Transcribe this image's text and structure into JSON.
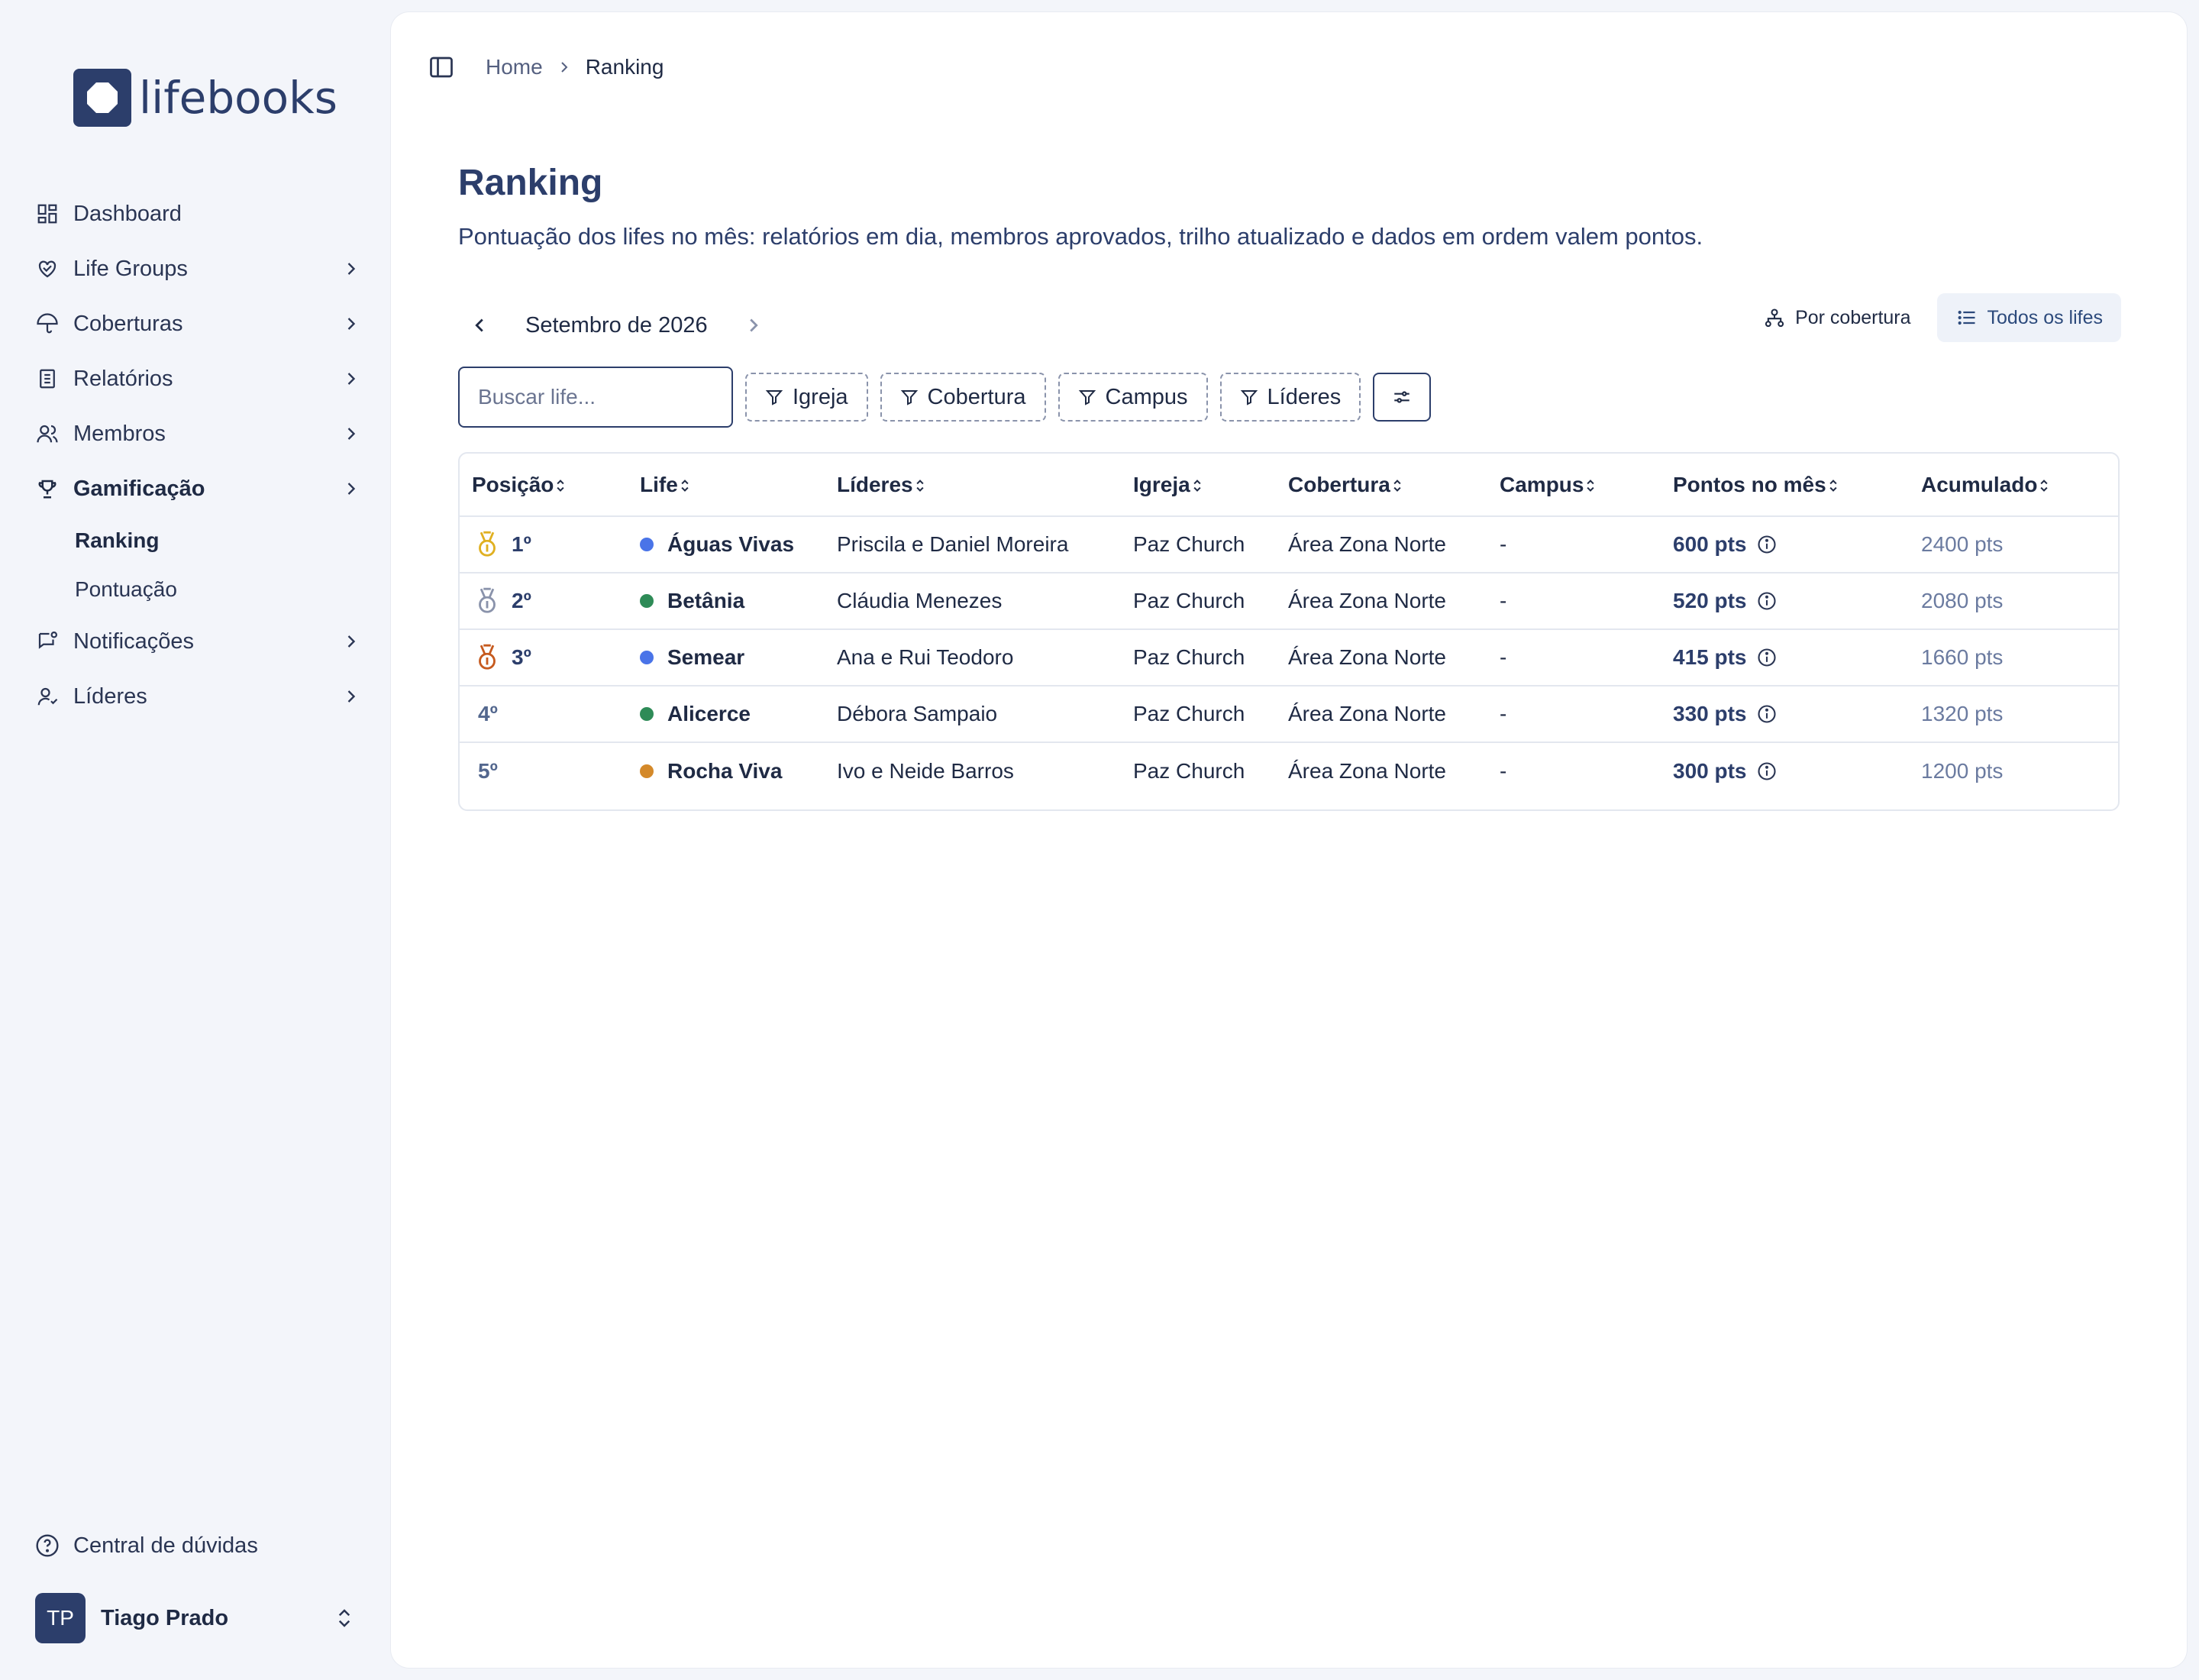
{
  "brand": {
    "name": "lifebooks"
  },
  "sidebar": {
    "items": [
      {
        "label": "Dashboard",
        "icon": "dashboard-icon",
        "has_children": false
      },
      {
        "label": "Life Groups",
        "icon": "heart-handshake-icon",
        "has_children": true
      },
      {
        "label": "Coberturas",
        "icon": "umbrella-icon",
        "has_children": true
      },
      {
        "label": "Relatórios",
        "icon": "report-icon",
        "has_children": true
      },
      {
        "label": "Membros",
        "icon": "users-icon",
        "has_children": true
      },
      {
        "label": "Gamificação",
        "icon": "trophy-icon",
        "has_children": true,
        "active": true
      }
    ],
    "sub_items": [
      {
        "label": "Ranking",
        "active": true
      },
      {
        "label": "Pontuação",
        "active": false
      }
    ],
    "items_after": [
      {
        "label": "Notificações",
        "icon": "message-bell-icon",
        "has_children": true
      },
      {
        "label": "Líderes",
        "icon": "user-leader-icon",
        "has_children": true
      }
    ],
    "help_label": "Central de dúvidas",
    "user": {
      "initials": "TP",
      "name": "Tiago Prado"
    }
  },
  "breadcrumb": {
    "home": "Home",
    "current": "Ranking"
  },
  "page": {
    "title": "Ranking",
    "subtitle": "Pontuação dos lifes no mês: relatórios em dia, membros aprovados, trilho atualizado e dados em ordem valem pontos."
  },
  "month_nav": {
    "label": "Setembro de 2026"
  },
  "view_toggle": {
    "by_coverage": "Por cobertura",
    "all_lifes": "Todos os lifes",
    "active": "all_lifes"
  },
  "filters": {
    "search_placeholder": "Buscar life...",
    "igreja": "Igreja",
    "cobertura": "Cobertura",
    "campus": "Campus",
    "lideres": "Líderes"
  },
  "table": {
    "headers": {
      "posicao": "Posição",
      "life": "Life",
      "lideres": "Líderes",
      "igreja": "Igreja",
      "cobertura": "Cobertura",
      "campus": "Campus",
      "pontos": "Pontos no mês",
      "acumulado": "Acumulado"
    },
    "rows": [
      {
        "pos": "1º",
        "medal": "gold",
        "life": "Águas Vivas",
        "dot": "#4a74e8",
        "lideres": "Priscila e Daniel Moreira",
        "igreja": "Paz Church",
        "cobertura": "Área Zona Norte",
        "campus": "-",
        "pontos": "600 pts",
        "acumulado": "2400 pts"
      },
      {
        "pos": "2º",
        "medal": "silver",
        "life": "Betânia",
        "dot": "#2e8b57",
        "lideres": "Cláudia Menezes",
        "igreja": "Paz Church",
        "cobertura": "Área Zona Norte",
        "campus": "-",
        "pontos": "520 pts",
        "acumulado": "2080 pts"
      },
      {
        "pos": "3º",
        "medal": "bronze",
        "life": "Semear",
        "dot": "#4a74e8",
        "lideres": "Ana e Rui Teodoro",
        "igreja": "Paz Church",
        "cobertura": "Área Zona Norte",
        "campus": "-",
        "pontos": "415 pts",
        "acumulado": "1660 pts"
      },
      {
        "pos": "4º",
        "medal": "",
        "life": "Alicerce",
        "dot": "#2e8b57",
        "lideres": "Débora Sampaio",
        "igreja": "Paz Church",
        "cobertura": "Área Zona Norte",
        "campus": "-",
        "pontos": "330 pts",
        "acumulado": "1320 pts"
      },
      {
        "pos": "5º",
        "medal": "",
        "life": "Rocha Viva",
        "dot": "#d4892a",
        "lideres": "Ivo e Neide Barros",
        "igreja": "Paz Church",
        "cobertura": "Área Zona Norte",
        "campus": "-",
        "pontos": "300 pts",
        "acumulado": "1200 pts"
      }
    ]
  },
  "colors": {
    "brand": "#2c3e6b",
    "gold": "#e0b021",
    "silver": "#8a93ab",
    "bronze": "#c65a1e"
  }
}
